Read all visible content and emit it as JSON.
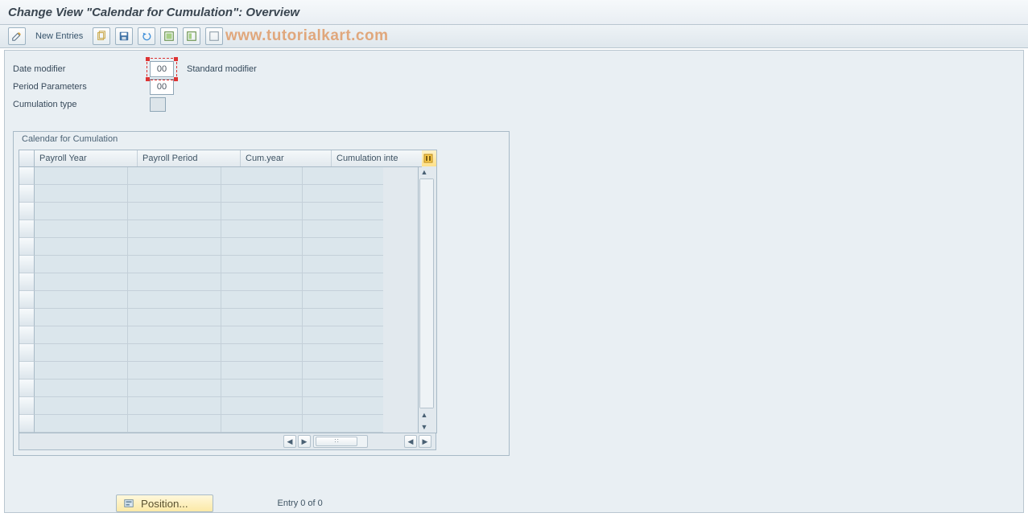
{
  "header": {
    "title": "Change View \"Calendar for Cumulation\": Overview"
  },
  "toolbar": {
    "new_entries": "New Entries",
    "icons": [
      "pencil",
      "copy",
      "save",
      "undo",
      "select-all",
      "select-block",
      "deselect"
    ]
  },
  "watermark": "www.tutorialkart.com",
  "form": {
    "date_modifier_label": "Date modifier",
    "date_modifier_value": "00",
    "date_modifier_desc": "Standard modifier",
    "period_params_label": "Period Parameters",
    "period_params_value": "00",
    "cumulation_type_label": "Cumulation type",
    "cumulation_type_value": ""
  },
  "group": {
    "title": "Calendar for Cumulation",
    "columns": [
      "Payroll Year",
      "Payroll Period",
      "Cum.year",
      "Cumulation inte"
    ],
    "row_count": 15
  },
  "footer": {
    "position_label": "Position...",
    "entry_text": "Entry 0 of 0"
  }
}
